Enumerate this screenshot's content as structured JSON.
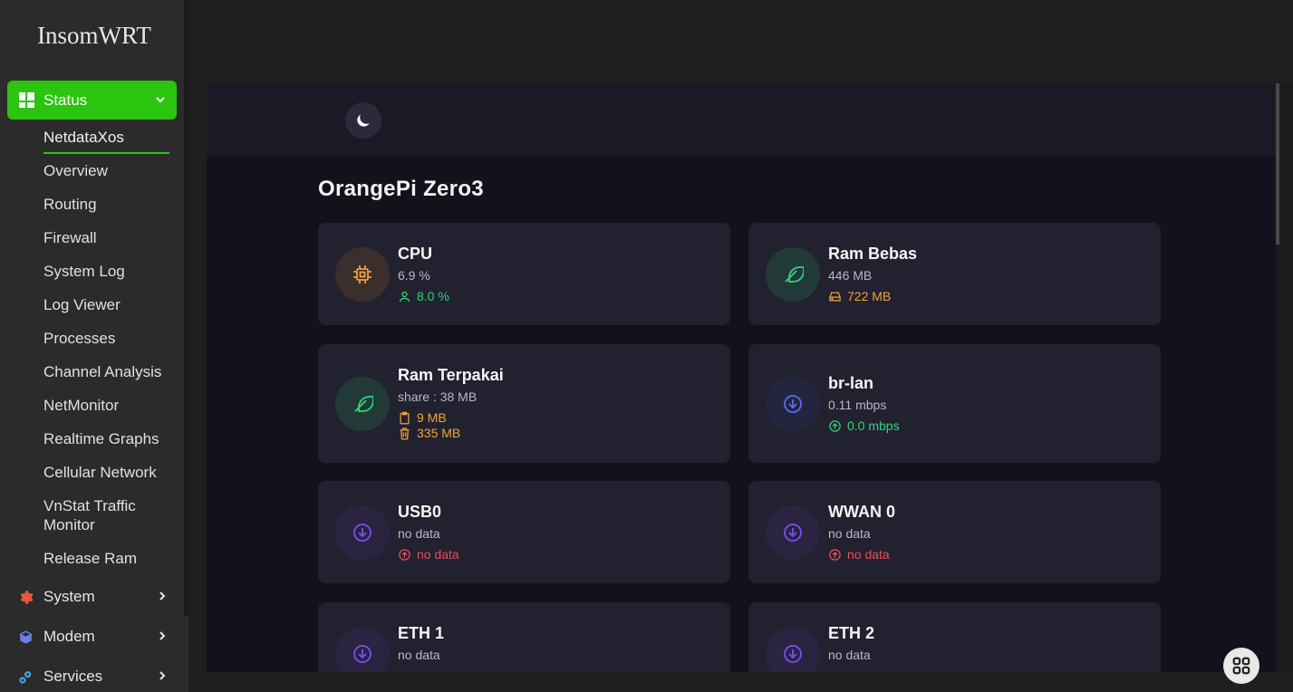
{
  "brand": "InsomWRT",
  "sidebar": {
    "status_label": "Status",
    "status_items": [
      "NetdataXos",
      "Overview",
      "Routing",
      "Firewall",
      "System Log",
      "Log Viewer",
      "Processes",
      "Channel Analysis",
      "NetMonitor",
      "Realtime Graphs",
      "Cellular Network",
      "VnStat Traffic Monitor",
      "Release Ram"
    ],
    "menus": [
      {
        "label": "System",
        "icon": "gear-icon",
        "color": "#e8563f"
      },
      {
        "label": "Modem",
        "icon": "cube-icon",
        "color": "#6a7fe0"
      },
      {
        "label": "Services",
        "icon": "cogs-icon",
        "color": "#3fa9e8"
      }
    ]
  },
  "page": {
    "title": "OrangePi Zero3",
    "theme_toggle_icon": "moon-icon"
  },
  "cards": [
    {
      "title": "CPU",
      "line1": "6.9 %",
      "line2": "8.0 %",
      "icon": "chip-icon",
      "line2_icon": "user-icon",
      "accent": "#f2a33a"
    },
    {
      "title": "Ram Bebas",
      "line1": "446 MB",
      "line2": "722 MB",
      "icon": "feather-icon",
      "line2_icon": "drive-icon",
      "accent": "#34d47a"
    },
    {
      "title": "Ram Terpakai",
      "line1": "share : 38 MB",
      "line2": "9 MB",
      "line3": "335 MB",
      "icon": "feather-icon",
      "line2_icon": "clipboard-icon",
      "line3_icon": "trash-icon",
      "accent": "#34d47a"
    },
    {
      "title": "br-lan",
      "line1": "0.11 mbps",
      "line2": "0.0 mbps",
      "icon": "download-icon",
      "line2_icon": "upload-icon",
      "accent": "#5b6cf0"
    },
    {
      "title": "USB0",
      "line1": "no data",
      "line2": "no data",
      "icon": "download-icon",
      "line2_icon": "upload-icon",
      "accent": "#7a4ef0"
    },
    {
      "title": "WWAN 0",
      "line1": "no data",
      "line2": "no data",
      "icon": "download-icon",
      "line2_icon": "upload-icon",
      "accent": "#7a4ef0"
    },
    {
      "title": "ETH 1",
      "line1": "no data",
      "icon": "download-icon",
      "accent": "#7a4ef0"
    },
    {
      "title": "ETH 2",
      "line1": "no data",
      "icon": "download-icon",
      "accent": "#7a4ef0"
    }
  ],
  "floating_button_icon": "apps-grid-icon"
}
